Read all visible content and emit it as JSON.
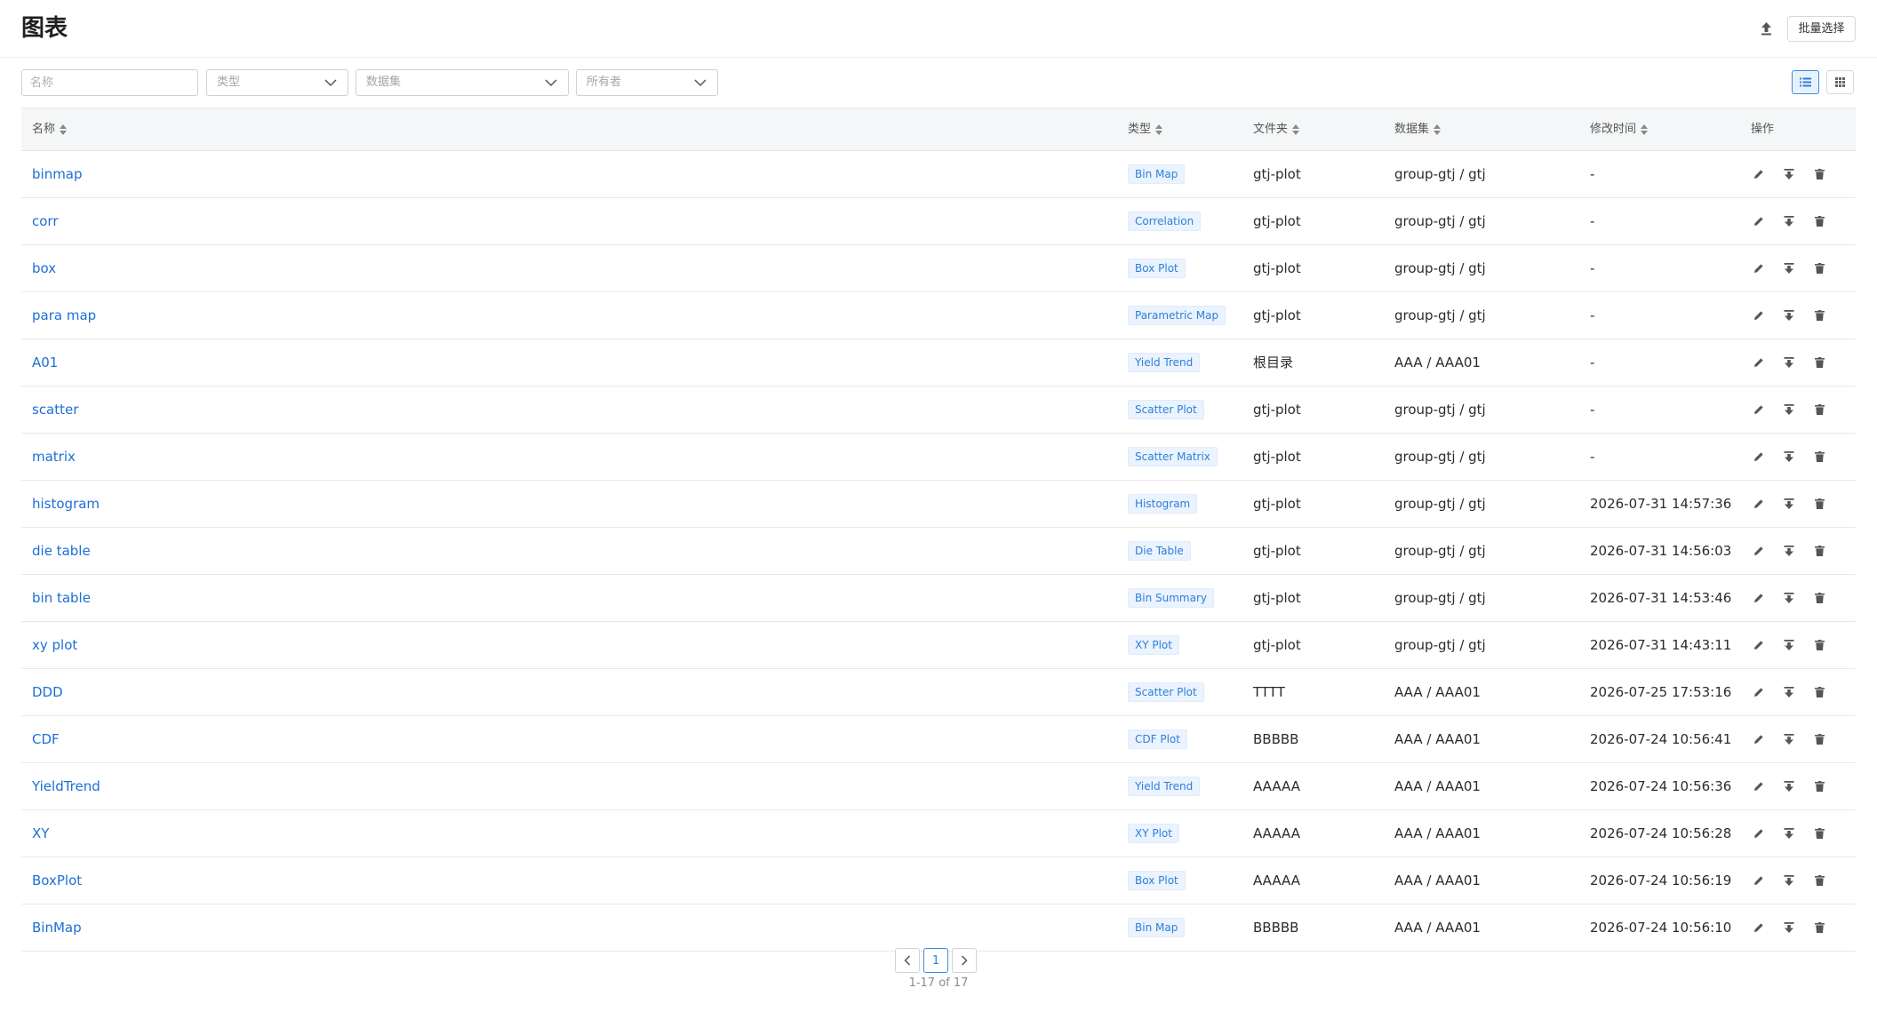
{
  "header": {
    "title": "图表",
    "batch_select_label": "批量选择",
    "upload_icon": "upload-icon"
  },
  "filters": {
    "name_placeholder": "名称",
    "type_placeholder": "类型",
    "dataset_placeholder": "数据集",
    "owner_placeholder": "所有者",
    "view_mode": "list"
  },
  "table": {
    "columns": {
      "name": "名称",
      "type": "类型",
      "folder": "文件夹",
      "dataset": "数据集",
      "modified": "修改时间",
      "actions": "操作"
    },
    "rows": [
      {
        "name": "binmap",
        "type": "Bin Map",
        "folder": "gtj-plot",
        "dataset": "group-gtj / gtj",
        "modified": "-"
      },
      {
        "name": "corr",
        "type": "Correlation",
        "folder": "gtj-plot",
        "dataset": "group-gtj / gtj",
        "modified": "-"
      },
      {
        "name": "box",
        "type": "Box Plot",
        "folder": "gtj-plot",
        "dataset": "group-gtj / gtj",
        "modified": "-"
      },
      {
        "name": "para map",
        "type": "Parametric Map",
        "folder": "gtj-plot",
        "dataset": "group-gtj / gtj",
        "modified": "-"
      },
      {
        "name": "A01",
        "type": "Yield Trend",
        "folder": "根目录",
        "dataset": "AAA / AAA01",
        "modified": "-"
      },
      {
        "name": "scatter",
        "type": "Scatter Plot",
        "folder": "gtj-plot",
        "dataset": "group-gtj / gtj",
        "modified": "-"
      },
      {
        "name": "matrix",
        "type": "Scatter Matrix",
        "folder": "gtj-plot",
        "dataset": "group-gtj / gtj",
        "modified": "-"
      },
      {
        "name": "histogram",
        "type": "Histogram",
        "folder": "gtj-plot",
        "dataset": "group-gtj / gtj",
        "modified": "2026-07-31 14:57:36"
      },
      {
        "name": "die table",
        "type": "Die Table",
        "folder": "gtj-plot",
        "dataset": "group-gtj / gtj",
        "modified": "2026-07-31 14:56:03"
      },
      {
        "name": "bin table",
        "type": "Bin Summary",
        "folder": "gtj-plot",
        "dataset": "group-gtj / gtj",
        "modified": "2026-07-31 14:53:46"
      },
      {
        "name": "xy plot",
        "type": "XY Plot",
        "folder": "gtj-plot",
        "dataset": "group-gtj / gtj",
        "modified": "2026-07-31 14:43:11"
      },
      {
        "name": "DDD",
        "type": "Scatter Plot",
        "folder": "TTTT",
        "dataset": "AAA / AAA01",
        "modified": "2026-07-25 17:53:16"
      },
      {
        "name": "CDF",
        "type": "CDF Plot",
        "folder": "BBBBB",
        "dataset": "AAA / AAA01",
        "modified": "2026-07-24 10:56:41"
      },
      {
        "name": "YieldTrend",
        "type": "Yield Trend",
        "folder": "AAAAA",
        "dataset": "AAA / AAA01",
        "modified": "2026-07-24 10:56:36"
      },
      {
        "name": "XY",
        "type": "XY Plot",
        "folder": "AAAAA",
        "dataset": "AAA / AAA01",
        "modified": "2026-07-24 10:56:28"
      },
      {
        "name": "BoxPlot",
        "type": "Box Plot",
        "folder": "AAAAA",
        "dataset": "AAA / AAA01",
        "modified": "2026-07-24 10:56:19"
      },
      {
        "name": "BinMap",
        "type": "Bin Map",
        "folder": "BBBBB",
        "dataset": "AAA / AAA01",
        "modified": "2026-07-24 10:56:10"
      }
    ],
    "row_actions": [
      "edit-icon",
      "download-icon",
      "delete-icon"
    ]
  },
  "pagination": {
    "current_page": "1",
    "info": "1-17 of 17"
  },
  "colors": {
    "link": "#1d6fd6",
    "tag_text": "#2f7fd8",
    "tag_bg": "#eaf3fe",
    "accent": "#3b8de0"
  }
}
